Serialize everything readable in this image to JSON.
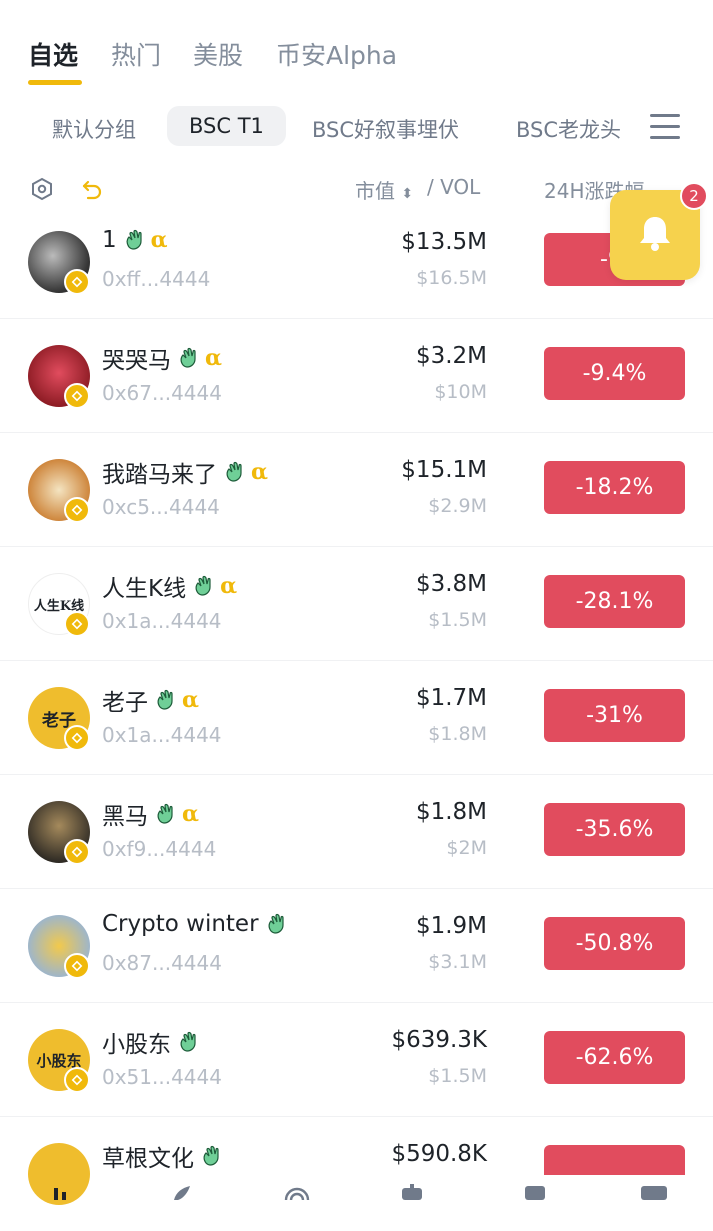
{
  "top_tabs": [
    {
      "label": "自选",
      "active": true
    },
    {
      "label": "热门",
      "active": false
    },
    {
      "label": "美股",
      "active": false
    },
    {
      "label": "币安Alpha",
      "active": false
    }
  ],
  "groups": [
    {
      "label": "默认分组",
      "active": false
    },
    {
      "label": "BSC T1",
      "active": true
    },
    {
      "label": "BSC好叙事埋伏",
      "active": false
    },
    {
      "label": "BSC老龙头",
      "active": false
    }
  ],
  "header": {
    "market_cap": "市值",
    "separator_vol": "/ VOL",
    "change_24h": "24H涨跌幅"
  },
  "notification": {
    "count": "2"
  },
  "tokens": [
    {
      "name": "1",
      "address": "0xff...4444",
      "market_cap": "$13.5M",
      "volume": "$16.5M",
      "change": "-9.",
      "alpha": "α",
      "has_alpha": true,
      "avatar_text": ""
    },
    {
      "name": "哭哭马",
      "address": "0x67...4444",
      "market_cap": "$3.2M",
      "volume": "$10M",
      "change": "-9.4%",
      "alpha": "α",
      "has_alpha": true,
      "avatar_text": ""
    },
    {
      "name": "我踏马来了",
      "address": "0xc5...4444",
      "market_cap": "$15.1M",
      "volume": "$2.9M",
      "change": "-18.2%",
      "alpha": "α",
      "has_alpha": true,
      "avatar_text": ""
    },
    {
      "name": "人生K线",
      "address": "0x1a...4444",
      "market_cap": "$3.8M",
      "volume": "$1.5M",
      "change": "-28.1%",
      "alpha": "α",
      "has_alpha": true,
      "avatar_text": "人生K线"
    },
    {
      "name": "老子",
      "address": "0x1a...4444",
      "market_cap": "$1.7M",
      "volume": "$1.8M",
      "change": "-31%",
      "alpha": "α",
      "has_alpha": true,
      "avatar_text": "老子"
    },
    {
      "name": "黑马",
      "address": "0xf9...4444",
      "market_cap": "$1.8M",
      "volume": "$2M",
      "change": "-35.6%",
      "alpha": "α",
      "has_alpha": true,
      "avatar_text": ""
    },
    {
      "name": "Crypto winter",
      "address": "0x87...4444",
      "market_cap": "$1.9M",
      "volume": "$3.1M",
      "change": "-50.8%",
      "alpha": "",
      "has_alpha": false,
      "avatar_text": ""
    },
    {
      "name": "小股东",
      "address": "0x51...4444",
      "market_cap": "$639.3K",
      "volume": "$1.5M",
      "change": "-62.6%",
      "alpha": "",
      "has_alpha": false,
      "avatar_text": "小股东"
    },
    {
      "name": "草根文化",
      "address": "",
      "market_cap": "$590.8K",
      "volume": "",
      "change": "",
      "alpha": "",
      "has_alpha": false,
      "avatar_text": ""
    }
  ],
  "colors": {
    "accent": "#f0b90b",
    "negative": "#e14c5e",
    "bell_bg": "#f6d24d"
  }
}
